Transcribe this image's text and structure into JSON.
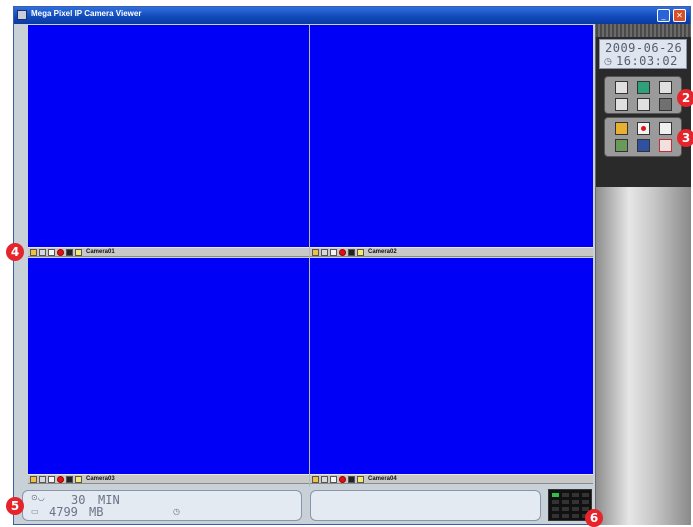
{
  "window": {
    "title": "Mega Pixel IP Camera Viewer",
    "minimize_glyph": "_",
    "close_glyph": "✕"
  },
  "colors": {
    "video_background": "#0000f6",
    "titlebar": "#1048b8",
    "badge": "#e5242b"
  },
  "cameras": [
    {
      "label": "Camera01"
    },
    {
      "label": "Camera02"
    },
    {
      "label": "Camera03"
    },
    {
      "label": "Camera04"
    }
  ],
  "camera_controls": [
    {
      "icon": "folder-icon",
      "style": "folder"
    },
    {
      "icon": "screen-icon",
      "style": "gray"
    },
    {
      "icon": "audio-icon",
      "style": "white"
    },
    {
      "icon": "record-icon",
      "style": "rec"
    },
    {
      "icon": "snapshot-icon",
      "style": "camera"
    },
    {
      "icon": "light-icon",
      "style": "yellow"
    }
  ],
  "clock": {
    "date": "2009-06-26",
    "time": "16:03:02",
    "icon": "clock-icon"
  },
  "layout_buttons": [
    {
      "icon": "single-view-icon",
      "style": "gray"
    },
    {
      "icon": "quad-view-icon",
      "style": "green"
    },
    {
      "icon": "nine-view-icon",
      "style": "gray"
    },
    {
      "icon": "sixteen-view-icon",
      "style": "gray"
    },
    {
      "icon": "six-view-icon",
      "style": "gray"
    },
    {
      "icon": "full-screen-icon",
      "style": "dark"
    }
  ],
  "action_buttons": [
    {
      "icon": "open-folder-icon",
      "style": "folder"
    },
    {
      "icon": "record-all-icon",
      "style": "rec"
    },
    {
      "icon": "blank-icon",
      "style": "blank"
    },
    {
      "icon": "settings-tool-icon",
      "style": "tool"
    },
    {
      "icon": "camera-setup-icon",
      "style": "cam"
    },
    {
      "icon": "schedule-icon",
      "style": "red"
    }
  ],
  "status": {
    "record_duration": "30",
    "record_unit": "MIN",
    "disk_space": "4799",
    "disk_unit": "MB"
  },
  "callouts": [
    "2",
    "3",
    "4",
    "5",
    "6"
  ]
}
